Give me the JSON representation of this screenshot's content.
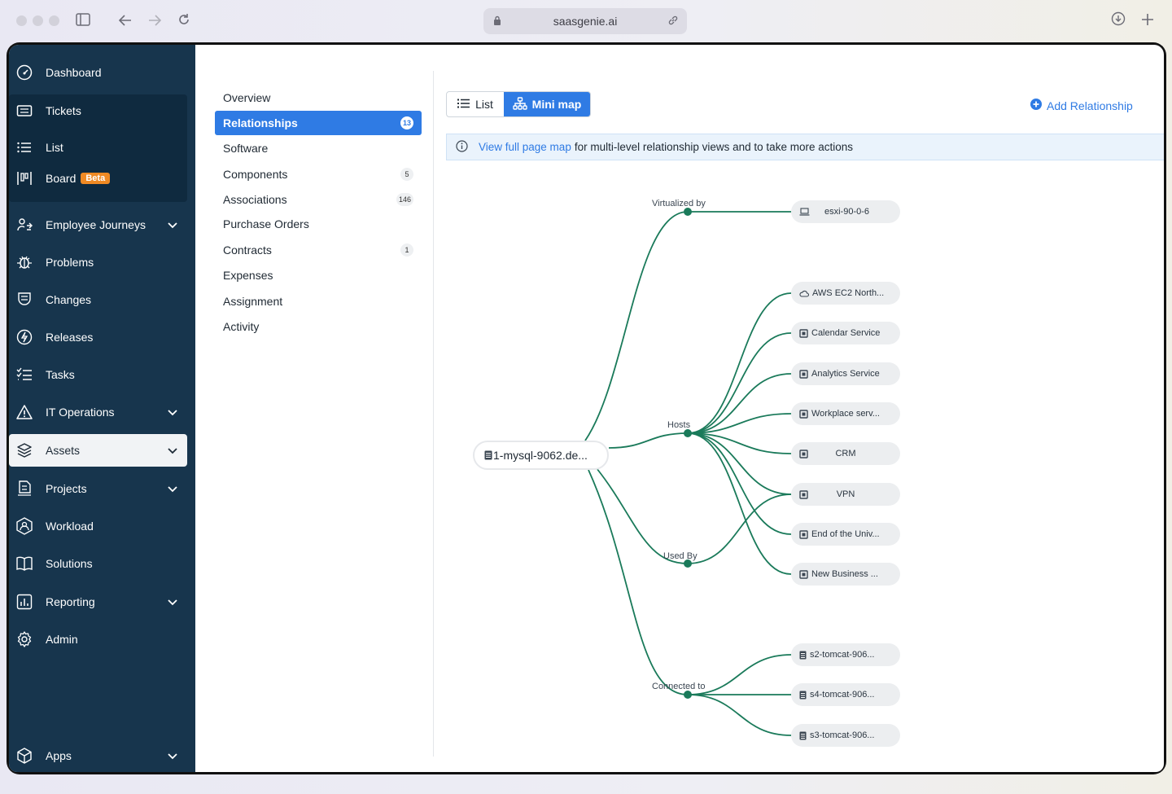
{
  "browser": {
    "url": "saasgenie.ai"
  },
  "sidebar": {
    "items": [
      {
        "label": "Dashboard",
        "icon": "dashboard-icon"
      },
      {
        "label": "Tickets",
        "icon": "ticket-icon"
      },
      {
        "label": "List",
        "icon": "list-icon"
      },
      {
        "label": "Board",
        "icon": "board-icon",
        "badge": "Beta"
      },
      {
        "label": "Employee Journeys",
        "icon": "journey-icon",
        "expandable": true
      },
      {
        "label": "Problems",
        "icon": "bug-icon"
      },
      {
        "label": "Changes",
        "icon": "changes-icon"
      },
      {
        "label": "Releases",
        "icon": "releases-icon"
      },
      {
        "label": "Tasks",
        "icon": "tasks-icon"
      },
      {
        "label": "IT Operations",
        "icon": "warning-icon",
        "expandable": true
      },
      {
        "label": "Assets",
        "icon": "layers-icon",
        "expandable": true,
        "active": true
      },
      {
        "label": "Projects",
        "icon": "projects-icon",
        "expandable": true
      },
      {
        "label": "Workload",
        "icon": "workload-icon"
      },
      {
        "label": "Solutions",
        "icon": "book-icon"
      },
      {
        "label": "Reporting",
        "icon": "reporting-icon",
        "expandable": true
      },
      {
        "label": "Admin",
        "icon": "gear-icon"
      },
      {
        "label": "Apps",
        "icon": "cube-icon",
        "expandable": true
      }
    ]
  },
  "subnav": {
    "items": [
      {
        "label": "Overview",
        "count": ""
      },
      {
        "label": "Relationships",
        "count": "13",
        "active": true
      },
      {
        "label": "Software",
        "count": ""
      },
      {
        "label": "Components",
        "count": "5"
      },
      {
        "label": "Associations",
        "count": "146"
      },
      {
        "label": "Purchase Orders",
        "count": ""
      },
      {
        "label": "Contracts",
        "count": "1"
      },
      {
        "label": "Expenses",
        "count": ""
      },
      {
        "label": "Assignment",
        "count": ""
      },
      {
        "label": "Activity",
        "count": ""
      }
    ]
  },
  "toolbar": {
    "list_label": "List",
    "minimap_label": "Mini map",
    "add_relationship_label": "Add Relationship"
  },
  "info": {
    "link_text": "View full page map",
    "text": "for multi-level relationship views and to take more actions"
  },
  "map": {
    "root": "1-mysql-9062.de...",
    "relations": [
      {
        "label": "Virtualized by",
        "nodes": [
          {
            "label": "esxi-90-0-6",
            "icon": "laptop-icon"
          }
        ]
      },
      {
        "label": "Hosts",
        "nodes": [
          {
            "label": "AWS EC2 North...",
            "icon": "cloud-icon"
          },
          {
            "label": "Calendar Service",
            "icon": "service-icon"
          },
          {
            "label": "Analytics Service",
            "icon": "service-icon"
          },
          {
            "label": "Workplace serv...",
            "icon": "service-icon"
          },
          {
            "label": "CRM",
            "icon": "service-icon"
          },
          {
            "label": "VPN",
            "icon": "service-icon"
          },
          {
            "label": "End of the Univ...",
            "icon": "service-icon"
          },
          {
            "label": "New Business ...",
            "icon": "service-icon"
          }
        ]
      },
      {
        "label": "Used By",
        "nodes": []
      },
      {
        "label": "Connected to",
        "nodes": [
          {
            "label": "s2-tomcat-906...",
            "icon": "server-icon"
          },
          {
            "label": "s4-tomcat-906...",
            "icon": "server-icon"
          },
          {
            "label": "s3-tomcat-906...",
            "icon": "server-icon"
          }
        ]
      }
    ],
    "link_color": "#1a7a5a"
  }
}
